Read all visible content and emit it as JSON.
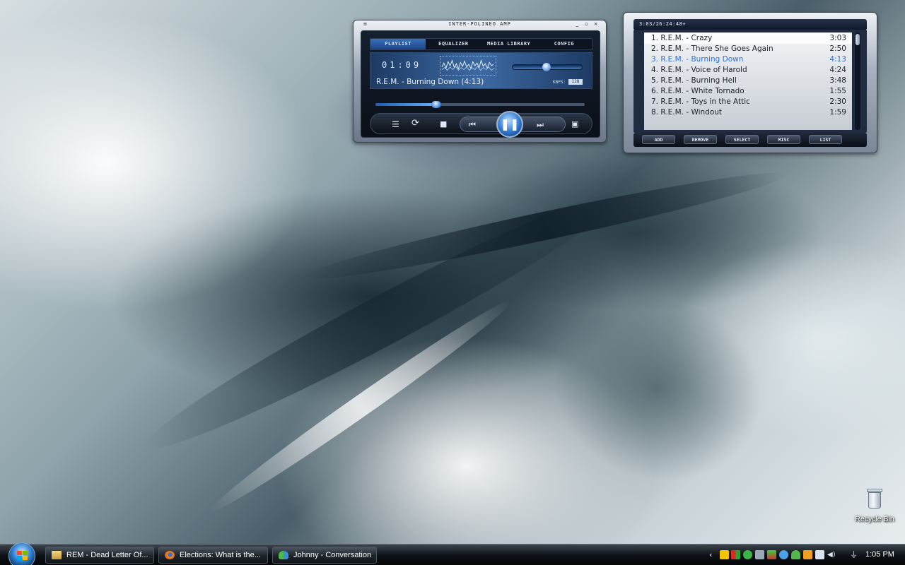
{
  "player": {
    "title": "INTER-POLINEO AMP",
    "tabs": [
      "PLAYLIST",
      "EQUALIZER",
      "MEDIA LIBRARY",
      "CONFIG"
    ],
    "time": "01:09",
    "track": "R.E.M. - Burning Down (4:13)",
    "kbps_label": "KBPS:",
    "kbps_value": "128",
    "seek_fraction": 0.29,
    "volume_fraction": 0.48
  },
  "playlist": {
    "header": "3:03/26:24:48+",
    "tracks": [
      {
        "name": "1. R.E.M. - Crazy",
        "duration": "3:03"
      },
      {
        "name": "2. R.E.M. - There She Goes Again",
        "duration": "2:50"
      },
      {
        "name": "3. R.E.M. - Burning Down",
        "duration": "4:13"
      },
      {
        "name": "4. R.E.M. - Voice of Harold",
        "duration": "4:24"
      },
      {
        "name": "5. R.E.M. - Burning Hell",
        "duration": "3:48"
      },
      {
        "name": "6. R.E.M. - White Tornado",
        "duration": "1:55"
      },
      {
        "name": "7. R.E.M. - Toys in the Attic",
        "duration": "2:30"
      },
      {
        "name": "8. R.E.M. - Windout",
        "duration": "1:59"
      }
    ],
    "current_index": 2,
    "buttons": [
      "ADD",
      "REMOVE",
      "SELECT",
      "MISC",
      "LIST"
    ]
  },
  "desktop": {
    "recycle_bin_label": "Recycle Bin"
  },
  "taskbar": {
    "items": [
      {
        "label": "REM - Dead Letter Of...",
        "icon": "folder-icon"
      },
      {
        "label": "Elections: What is the...",
        "icon": "firefox-icon"
      },
      {
        "label": "Johnny - Conversation",
        "icon": "messenger-icon"
      }
    ],
    "clock": "1:05 PM"
  },
  "colors": {
    "accent_blue": "#2f6fd6",
    "taskbar": "#0c1014"
  }
}
